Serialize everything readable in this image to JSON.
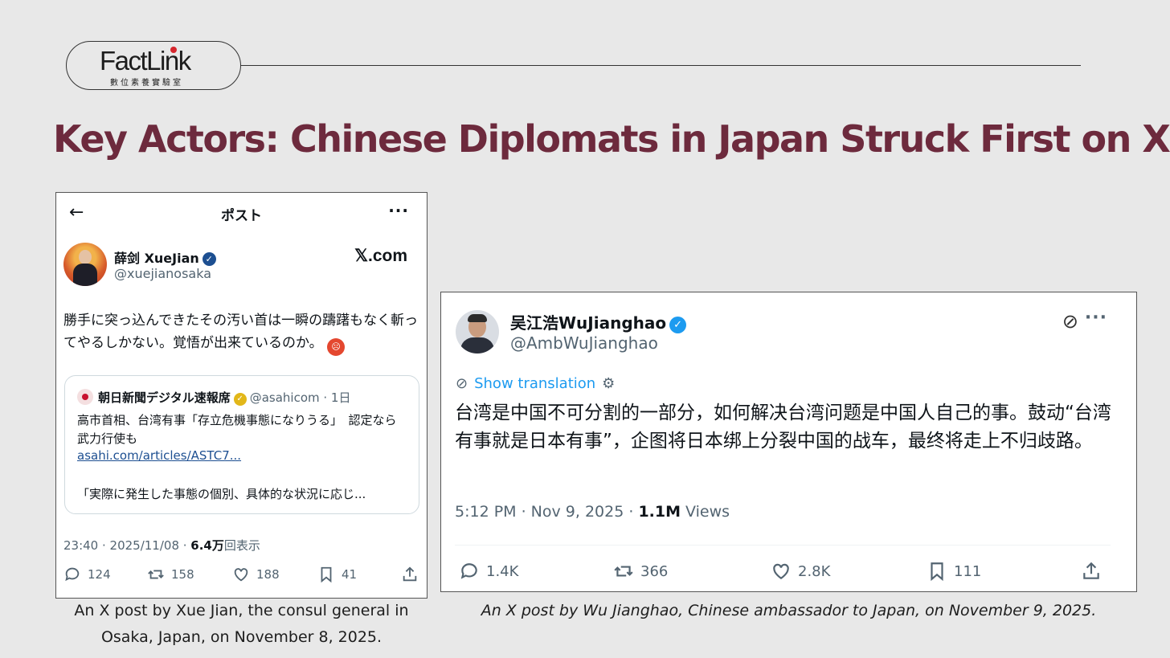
{
  "header": {
    "logo_word": "FactLink",
    "logo_subtitle": "數位素養實驗室",
    "title": "Key Actors: Chinese Diplomats in Japan Struck First on X"
  },
  "colors": {
    "title": "#6d2a3d",
    "verified_blue": "#1d9bf0",
    "verified_navy": "#1d4f91",
    "link": "#1d4f91"
  },
  "post_left": {
    "nav_title": "ポスト",
    "back_icon": "←",
    "more_icon": "···",
    "author_name": "薛剑 XueJian",
    "verified_icon": "✓",
    "handle": "@xuejianosaka",
    "brand": "𝕏.com",
    "body": "勝手に突っ込んできたその汚い首は一瞬の躊躇もなく斬ってやるしかない。覚悟が出来ているのか。",
    "emoji_icon": "angry-face-icon",
    "quote": {
      "author": "朝日新聞デジタル速報席",
      "handle_time": "@asahicom · 1日",
      "text": "高市首相、台湾有事「存立危機事態になりうる」　認定なら武力行使も",
      "link": "asahi.com/articles/ASTC7...",
      "excerpt": "「実際に発生した事態の個別、具体的な状況に応じ..."
    },
    "meta_time": "23:40 · 2025/11/08 · ",
    "meta_views_num": "6.4万",
    "meta_views_label": "回表示",
    "actions": {
      "replies": "124",
      "reposts": "158",
      "likes": "188",
      "bookmarks": "41"
    }
  },
  "post_right": {
    "author_name": "吴江浩WuJianghao",
    "verified_icon": "✓",
    "handle": "@AmbWuJianghao",
    "grok_icon": "⊘",
    "more_icon": "···",
    "translate_label": "Show translation",
    "translate_icon": "⚙",
    "body": "台湾是中国不可分割的一部分，如何解决台湾问题是中国人自己的事。鼓动“台湾有事就是日本有事”，企图将日本绑上分裂中国的战车，最终将走上不归歧路。",
    "meta_time": "5:12 PM · Nov 9, 2025 · ",
    "meta_views_num": "1.1M",
    "meta_views_label": " Views",
    "actions": {
      "replies": "1.4K",
      "reposts": "366",
      "likes": "2.8K",
      "bookmarks": "111"
    }
  },
  "captions": {
    "left": "An X post by Xue Jian, the consul general in Osaka, Japan, on November 8, 2025.",
    "right": "An X post by Wu Jianghao, Chinese ambassador to Japan, on November 9, 2025."
  }
}
